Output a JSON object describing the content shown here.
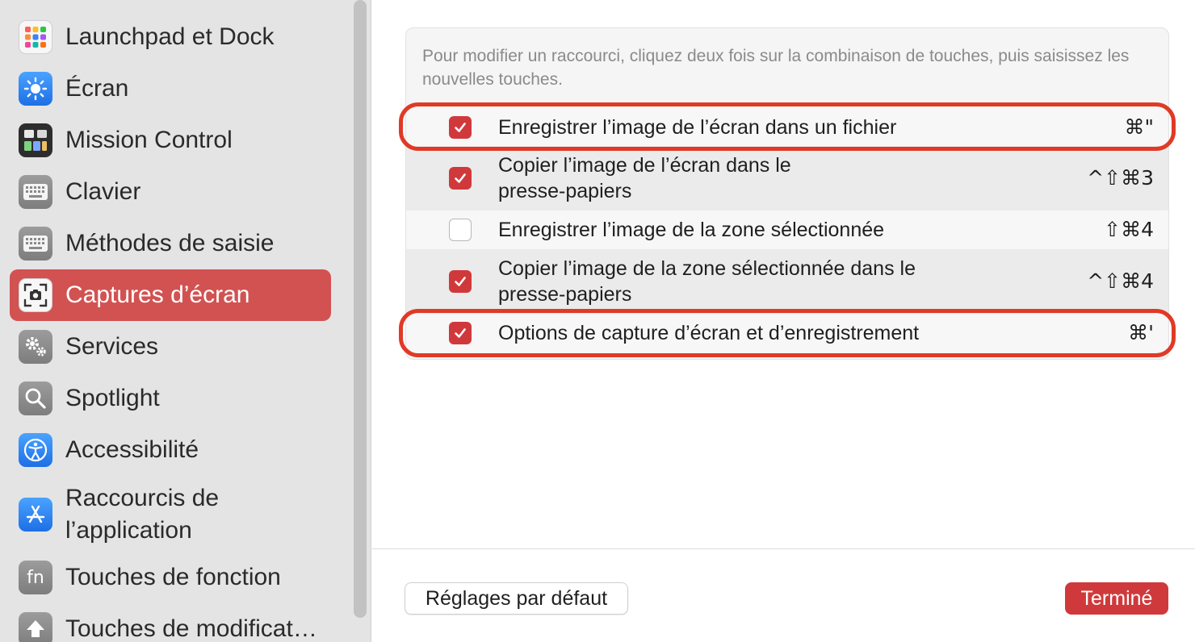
{
  "sidebar": {
    "items": [
      {
        "label": "Launchpad et Dock",
        "icon": "launchpad-icon"
      },
      {
        "label": "Écran",
        "icon": "display-brightness-icon"
      },
      {
        "label": "Mission Control",
        "icon": "mission-control-icon"
      },
      {
        "label": "Clavier",
        "icon": "keyboard-icon"
      },
      {
        "label": "Méthodes de saisie",
        "icon": "keyboard-input-icon"
      },
      {
        "label": "Captures d’écran",
        "icon": "screenshot-camera-icon",
        "selected": true
      },
      {
        "label": "Services",
        "icon": "gears-icon"
      },
      {
        "label": "Spotlight",
        "icon": "magnifier-icon"
      },
      {
        "label": "Accessibilité",
        "icon": "accessibility-icon"
      },
      {
        "label": "Raccourcis de l’application",
        "icon": "app-store-icon"
      },
      {
        "label": "Touches de fonction",
        "icon": "fn-key-icon",
        "icon_text": "fn"
      },
      {
        "label": "Touches de modificat…",
        "icon": "modifier-keys-icon"
      }
    ]
  },
  "main": {
    "hint": "Pour modifier un raccourci, cliquez deux fois sur la combinaison de touches, puis saisissez les nouvelles touches.",
    "shortcuts": [
      {
        "label": "Enregistrer l’image de l’écran dans un fichier",
        "shortcut": "⌘\"",
        "checked": true,
        "highlighted": true
      },
      {
        "label": "Copier l’image de l’écran dans le presse-papiers",
        "shortcut": "^⇧⌘3",
        "checked": true
      },
      {
        "label": "Enregistrer l’image de la zone sélectionnée",
        "shortcut": "⇧⌘4",
        "checked": false
      },
      {
        "label": "Copier l’image de la zone sélectionnée dans le presse-papiers",
        "shortcut": "^⇧⌘4",
        "checked": true
      },
      {
        "label": "Options de capture d’écran et d’enregistrement",
        "shortcut": "⌘'",
        "checked": true,
        "highlighted": true
      }
    ],
    "reset_button": "Réglages par défaut",
    "done_button": "Terminé"
  },
  "colors": {
    "accent": "#d0393b",
    "sidebar_selected": "#d25252",
    "highlight_ring": "#e03a26"
  }
}
